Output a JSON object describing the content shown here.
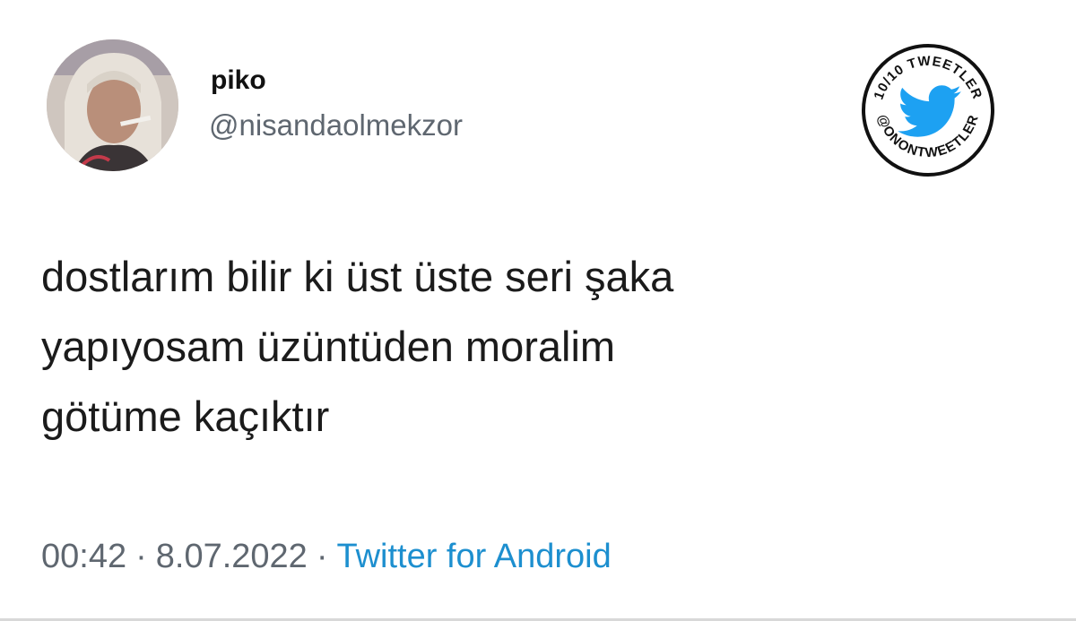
{
  "author": {
    "display_name": "piko",
    "handle": "@nisandaolmekzor",
    "avatar_icon": "user-photo-avatar"
  },
  "tweet": {
    "text": "dostlarım bilir ki üst üste seri şaka\nyapıyosam üzüntüden moralim\ngötüme kaçıktır"
  },
  "meta": {
    "time": "00:42",
    "separator": "·",
    "date": "8.07.2022",
    "source": "Twitter for Android"
  },
  "badge": {
    "top_text": "10/10 TWEETLER",
    "bottom_text": "@ONONTWEETLER",
    "icon": "twitter-bird-icon"
  },
  "colors": {
    "link": "#1d8fcf",
    "secondary_text": "#5f6770",
    "twitter_blue": "#1da1f2"
  }
}
